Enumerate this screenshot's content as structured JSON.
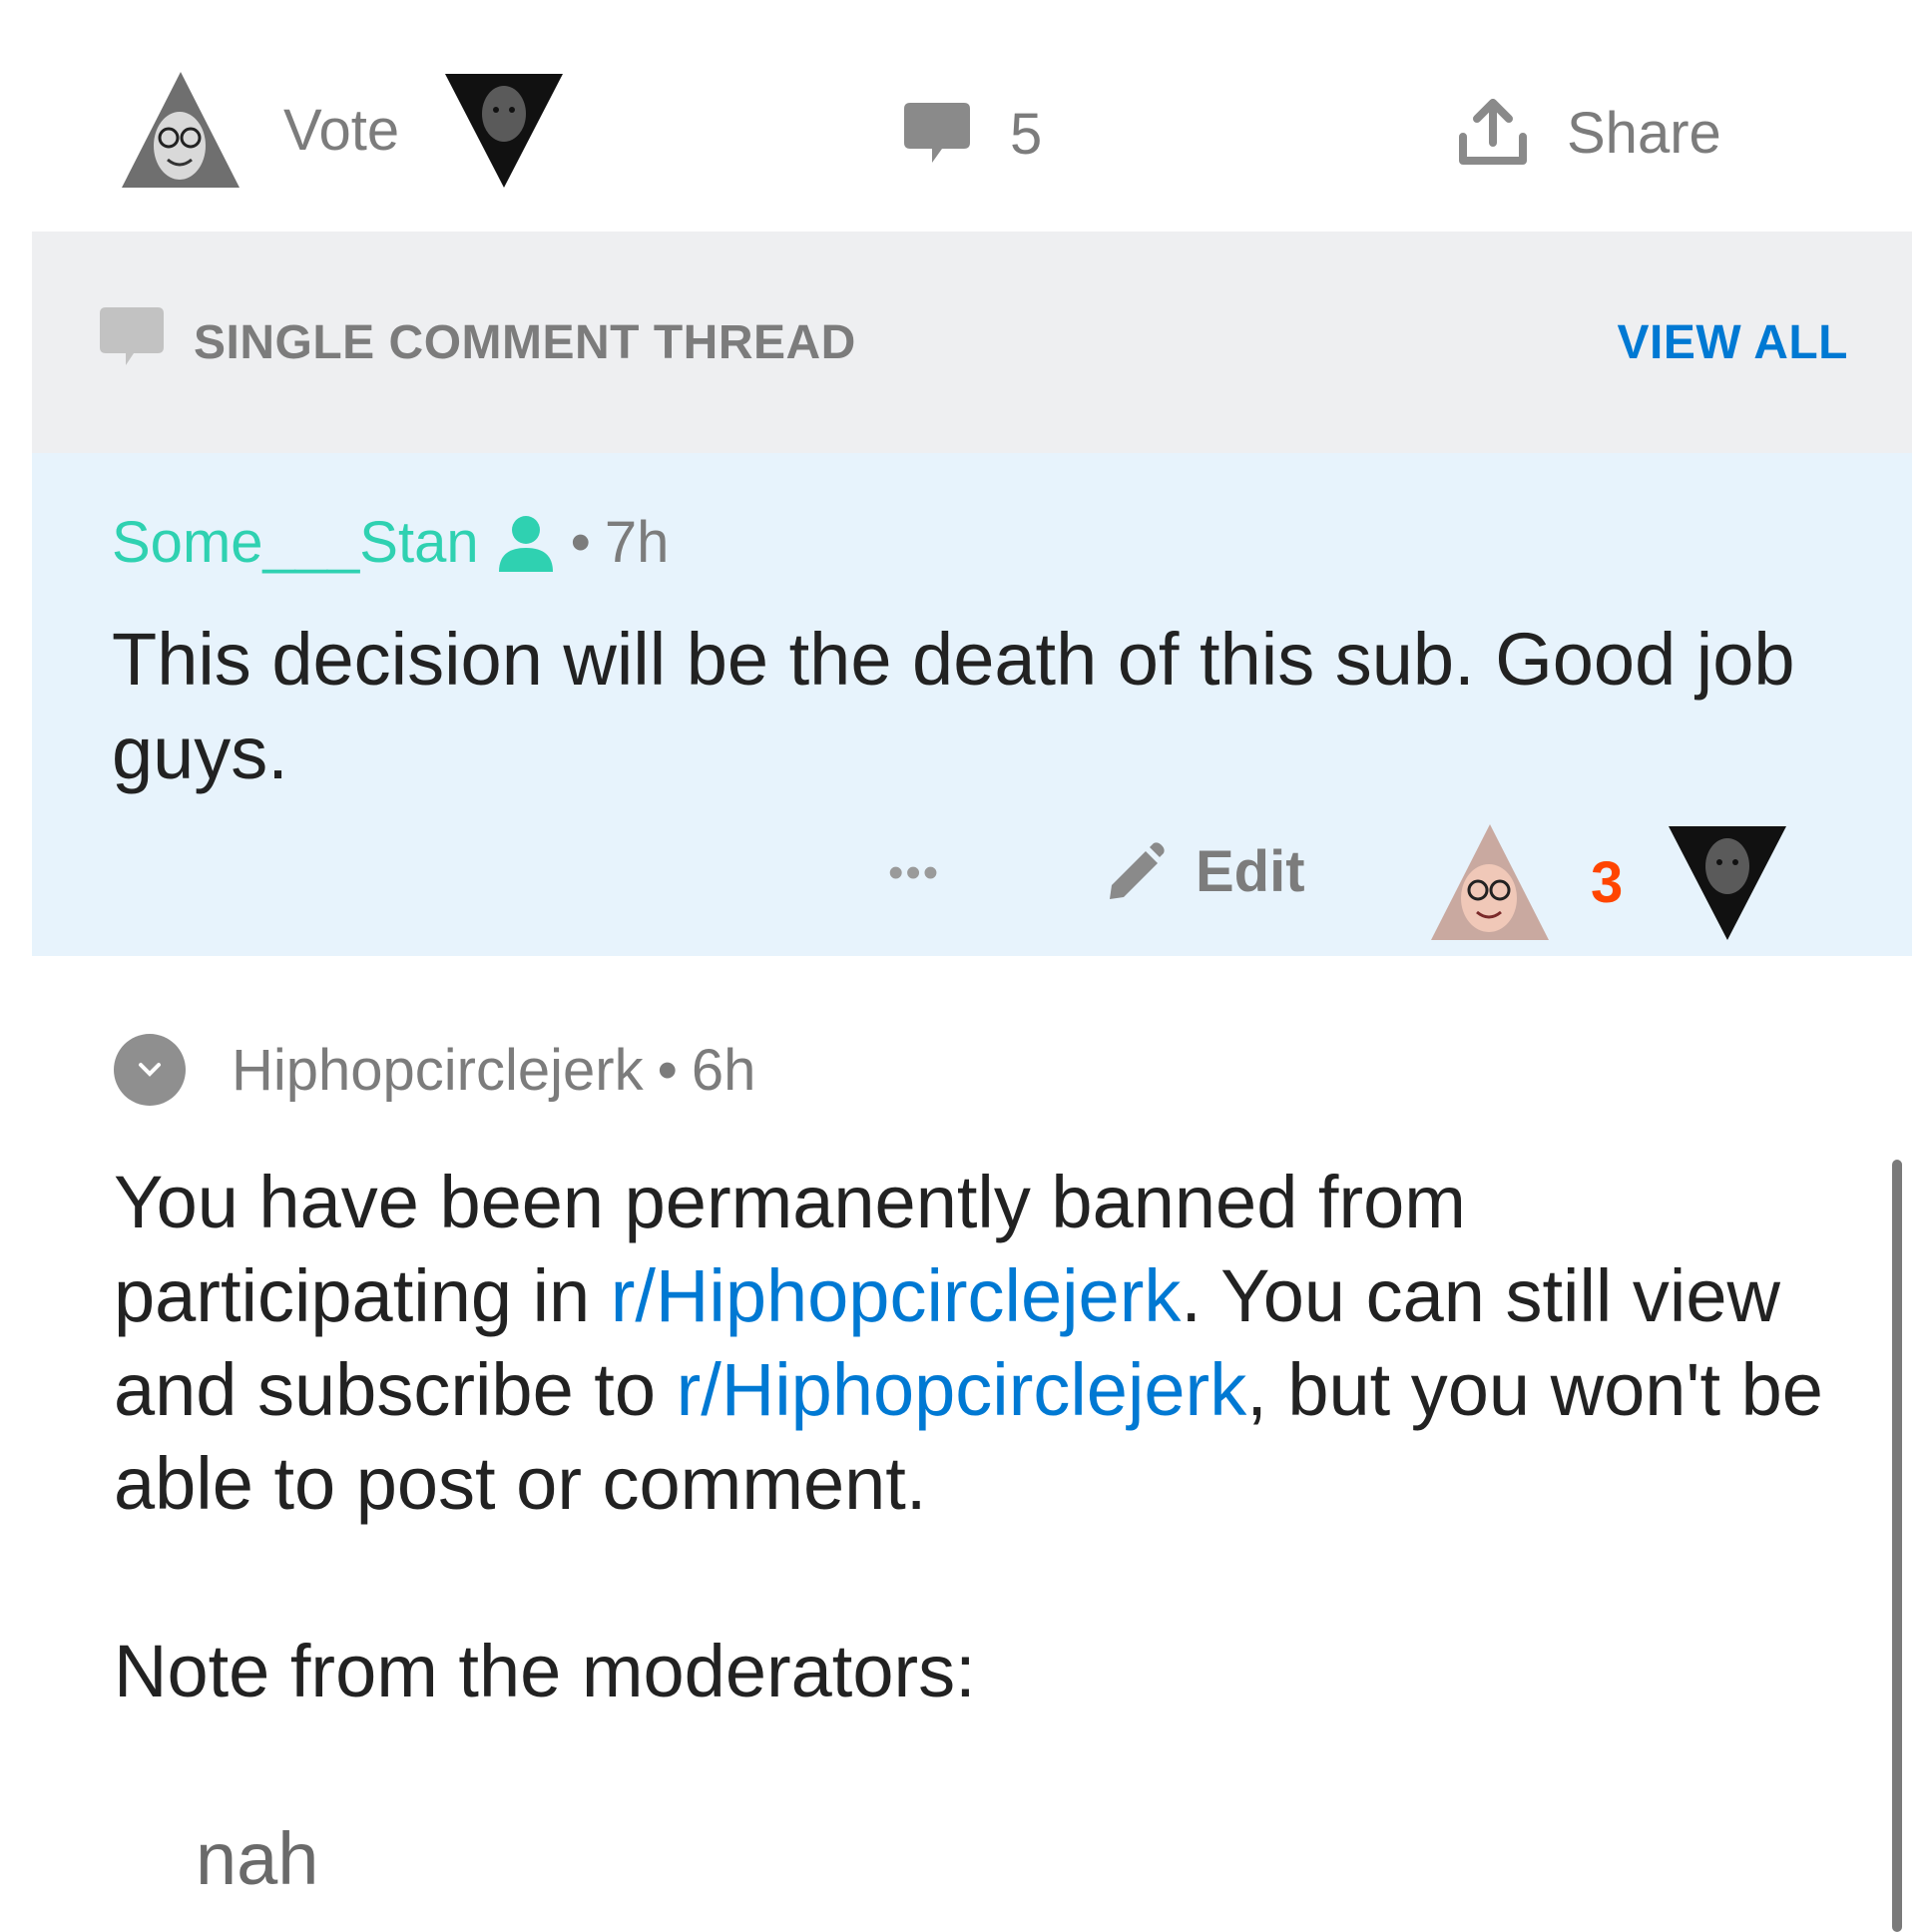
{
  "action_bar": {
    "vote_label": "Vote",
    "comments_count": "5",
    "share_label": "Share"
  },
  "thread_header": {
    "title": "SINGLE COMMENT THREAD",
    "view_all": "VIEW ALL"
  },
  "comment": {
    "author": "Some___Stan",
    "separator": "•",
    "time": "7h",
    "body": "This decision will be the death of this sub. Good job guys.",
    "more": "•••",
    "edit_label": "Edit",
    "score": "3"
  },
  "mod_message": {
    "author": "Hiphopcirclejerk",
    "separator": "•",
    "time": "6h",
    "para1_part1": "You have been permanently banned from participating in ",
    "sub_link_1": "r/Hiphopcirclejerk",
    "para1_part2": ". You can still view and subscribe to ",
    "sub_link_2": "r/Hiphopcirclejerk",
    "para1_part3": ", but you won't be able to post or comment.",
    "note_heading": "Note from the moderators:",
    "note_text": "nah"
  },
  "colors": {
    "author": "#2fd1b1",
    "link": "#0079d3",
    "score": "#ff4500",
    "header_bg": "#eeeff1",
    "highlight_bg": "#e7f3fc",
    "muted_text": "#7c7c7c"
  },
  "icons": [
    "upvote-avatar-icon",
    "downvote-avatar-icon",
    "comment-bubble-icon",
    "share-icon",
    "chat-icon",
    "user-icon",
    "pencil-icon",
    "chevron-down-icon"
  ]
}
